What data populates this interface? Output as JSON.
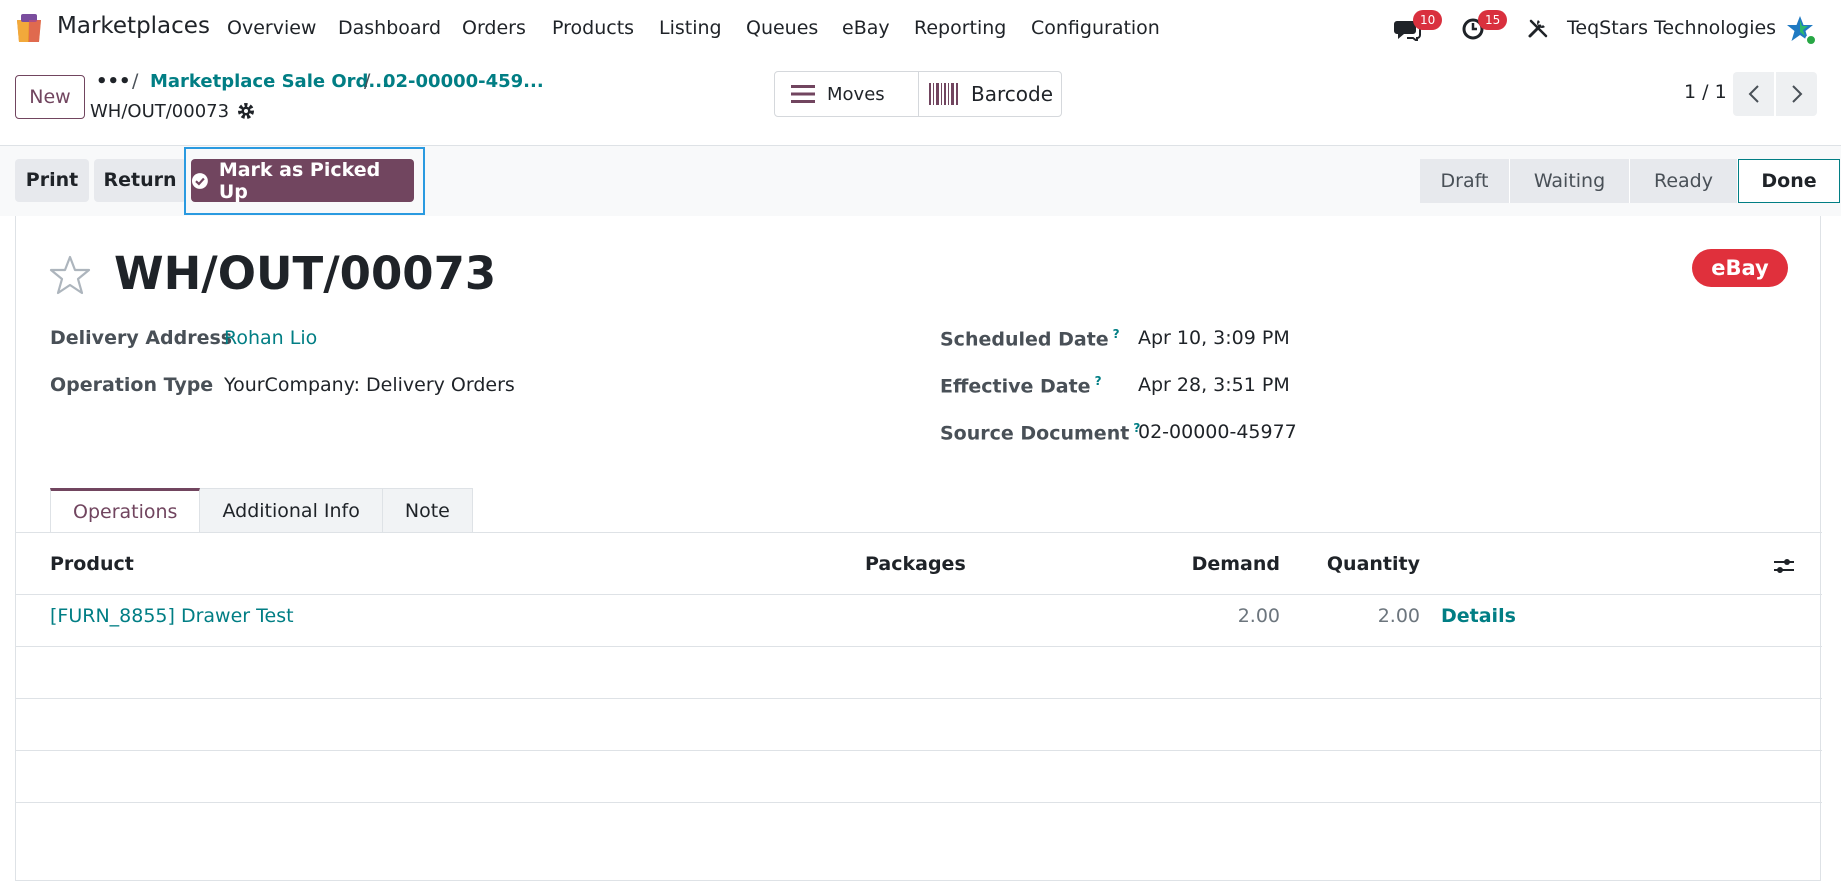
{
  "navbar": {
    "app_name": "Marketplaces",
    "menu": [
      "Overview",
      "Dashboard",
      "Orders",
      "Products",
      "Listing",
      "Queues",
      "eBay",
      "Reporting",
      "Configuration"
    ],
    "messages_badge": "10",
    "activities_badge": "15",
    "company": "TeqStars Technologies"
  },
  "control_panel": {
    "new_label": "New",
    "breadcrumb_dots": "•••",
    "breadcrumb_sep": "/",
    "breadcrumbs": [
      "Marketplace Sale Ord...",
      "02-00000-459..."
    ],
    "current": "WH/OUT/00073",
    "smart_buttons": {
      "moves": "Moves",
      "barcode": "Barcode"
    },
    "pager": "1 / 1"
  },
  "actions": {
    "print": "Print",
    "return": "Return",
    "mark_picked_up": "Mark as Picked Up"
  },
  "statusbar": {
    "stages": [
      "Draft",
      "Waiting",
      "Ready",
      "Done"
    ],
    "current": "Done"
  },
  "form": {
    "title": "WH/OUT/00073",
    "ribbon": "eBay",
    "delivery_address_label": "Delivery Address",
    "delivery_address": "Rohan Lio",
    "operation_type_label": "Operation Type",
    "operation_type": "YourCompany: Delivery Orders",
    "scheduled_date_label": "Scheduled Date",
    "scheduled_date": "Apr 10, 3:09 PM",
    "effective_date_label": "Effective Date",
    "effective_date": "Apr 28, 3:51 PM",
    "source_document_label": "Source Document",
    "source_document": "02-00000-45977",
    "help_mark": "?"
  },
  "tabs": [
    "Operations",
    "Additional Info",
    "Note"
  ],
  "table": {
    "headers": {
      "product": "Product",
      "packages": "Packages",
      "demand": "Demand",
      "quantity": "Quantity"
    },
    "rows": [
      {
        "product": "[FURN_8855] Drawer Test",
        "packages": "",
        "demand": "2.00",
        "quantity": "2.00",
        "details": "Details"
      }
    ]
  },
  "colors": {
    "brand": "#71455f",
    "link": "#017e84",
    "badge": "#d9303e",
    "ribbon": "#e0303c",
    "highlight": "#2a9ae0"
  }
}
